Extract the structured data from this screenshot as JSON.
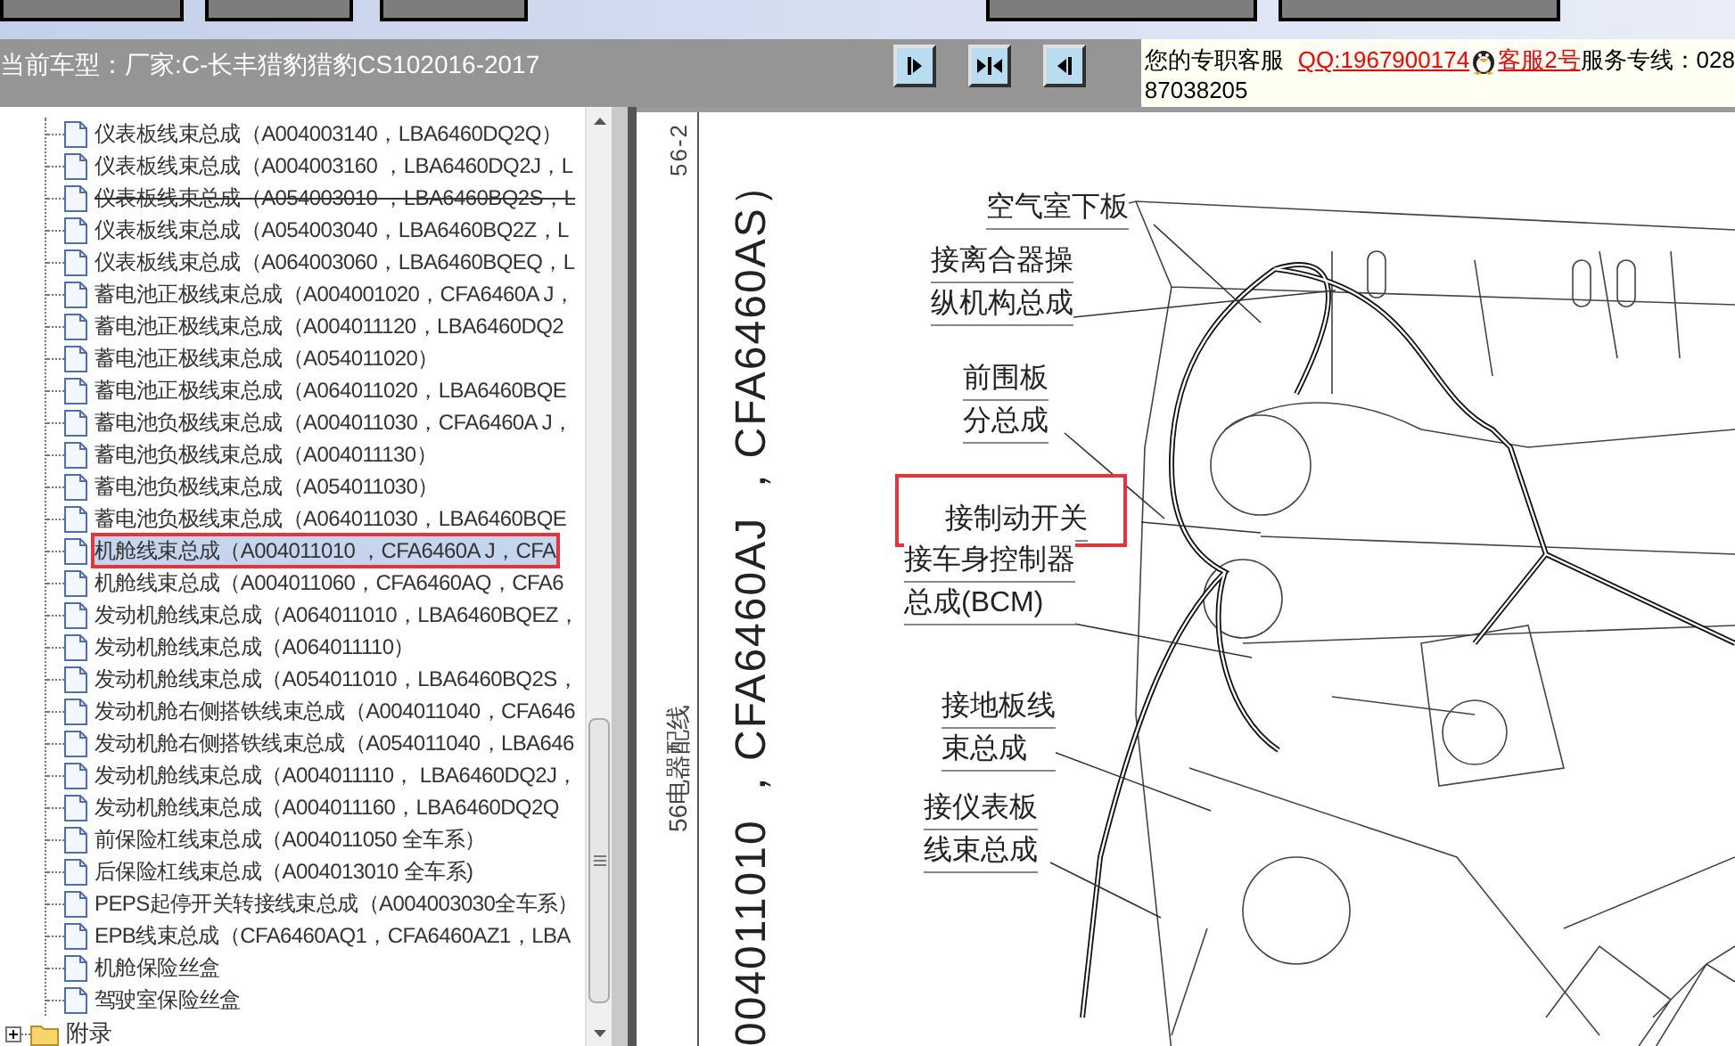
{
  "header": {
    "car_model": "当前车型：厂家:C-长丰猎豹猎豹CS102016-2017",
    "view_buttons": [
      {
        "kind": "right"
      },
      {
        "kind": "split"
      },
      {
        "kind": "left"
      }
    ],
    "support": {
      "intro": "您的专职客服",
      "qq_link": "QQ:1967900174",
      "service_link": "客服2号",
      "phone_label": "服务专线：028",
      "phone_rest": "87038205"
    }
  },
  "tree": {
    "visible_children": [
      {
        "label": "仪表板线束总成（A004003140，LBA6460DQ2Q）",
        "selected": false,
        "struck": false,
        "annotated": false
      },
      {
        "label": "仪表板线束总成（A004003160 ，LBA6460DQ2J，L",
        "selected": false,
        "struck": false,
        "annotated": false
      },
      {
        "label": "仪表板线束总成（A054003010 ，LBA6460BQ2S，L",
        "selected": false,
        "struck": true,
        "annotated": false
      },
      {
        "label": "仪表板线束总成（A054003040，LBA6460BQ2Z，L",
        "selected": false,
        "struck": false,
        "annotated": false
      },
      {
        "label": "仪表板线束总成（A064003060，LBA6460BQEQ，L",
        "selected": false,
        "struck": false,
        "annotated": false
      },
      {
        "label": "蓄电池正极线束总成（A004001020，CFA6460A J，",
        "selected": false,
        "struck": false,
        "annotated": false
      },
      {
        "label": "蓄电池正极线束总成（A004011120，LBA6460DQ2",
        "selected": false,
        "struck": false,
        "annotated": false
      },
      {
        "label": "蓄电池正极线束总成（A054011020）",
        "selected": false,
        "struck": false,
        "annotated": false
      },
      {
        "label": "蓄电池正极线束总成（A064011020，LBA6460BQE",
        "selected": false,
        "struck": false,
        "annotated": false
      },
      {
        "label": "蓄电池负极线束总成（A004011030，CFA6460A J，",
        "selected": false,
        "struck": false,
        "annotated": false
      },
      {
        "label": "蓄电池负极线束总成（A004011130）",
        "selected": false,
        "struck": false,
        "annotated": false
      },
      {
        "label": "蓄电池负极线束总成（A054011030）",
        "selected": false,
        "struck": false,
        "annotated": false
      },
      {
        "label": "蓄电池负极线束总成（A064011030，LBA6460BQE",
        "selected": false,
        "struck": false,
        "annotated": false
      },
      {
        "label": "机舱线束总成（A004011010 ，CFA6460A J，CFA",
        "selected": true,
        "struck": false,
        "annotated": true
      },
      {
        "label": "机舱线束总成（A004011060，CFA6460AQ，CFA6",
        "selected": false,
        "struck": false,
        "annotated": false
      },
      {
        "label": "发动机舱线束总成（A064011010，LBA6460BQEZ，",
        "selected": false,
        "struck": false,
        "annotated": false
      },
      {
        "label": "发动机舱线束总成（A064011110）",
        "selected": false,
        "struck": false,
        "annotated": false
      },
      {
        "label": "发动机舱线束总成（A054011010，LBA6460BQ2S，",
        "selected": false,
        "struck": false,
        "annotated": false
      },
      {
        "label": "发动机舱右侧搭铁线束总成（A004011040，CFA646",
        "selected": false,
        "struck": false,
        "annotated": false
      },
      {
        "label": "发动机舱右侧搭铁线束总成（A054011040，LBA646",
        "selected": false,
        "struck": false,
        "annotated": false
      },
      {
        "label": "发动机舱线束总成（A004011110， LBA6460DQ2J，",
        "selected": false,
        "struck": false,
        "annotated": false
      },
      {
        "label": "发动机舱线束总成（A004011160，LBA6460DQ2Q",
        "selected": false,
        "struck": false,
        "annotated": false
      },
      {
        "label": "前保险杠线束总成（A004011050 全车系）",
        "selected": false,
        "struck": false,
        "annotated": false
      },
      {
        "label": "后保险杠线束总成（A004013010 全车系)",
        "selected": false,
        "struck": false,
        "annotated": false
      },
      {
        "label": "PEPS起停开关转接线束总成（A004003030全车系）",
        "selected": false,
        "struck": false,
        "annotated": false
      },
      {
        "label": "EPB线束总成（CFA6460AQ1，CFA6460AZ1，LBA",
        "selected": false,
        "struck": false,
        "annotated": false
      },
      {
        "label": "机舱保险丝盒",
        "selected": false,
        "struck": false,
        "annotated": false
      },
      {
        "label": "驾驶室保险丝盒",
        "selected": false,
        "struck": false,
        "annotated": false
      }
    ],
    "roots": [
      {
        "label": "附录",
        "expanded": false
      }
    ]
  },
  "document": {
    "page_number": "56-2",
    "section": "56电器配线",
    "heading": "004011010 ，CFA6460AJ ，CFA6460AS）",
    "callouts": [
      {
        "lines": [
          "空气室下板"
        ],
        "annotated": false
      },
      {
        "lines": [
          "接离合器操",
          "纵机构总成"
        ],
        "annotated": false
      },
      {
        "lines": [
          "前围板",
          "分总成"
        ],
        "annotated": false
      },
      {
        "lines": [
          "接制动开关"
        ],
        "annotated": true
      },
      {
        "lines": [
          "接车身控制器",
          "总成(BCM)"
        ],
        "annotated": false
      },
      {
        "lines": [
          "接地板线",
          "束总成"
        ],
        "annotated": false
      },
      {
        "lines": [
          "接仪表板",
          "线束总成"
        ],
        "annotated": false
      }
    ]
  }
}
